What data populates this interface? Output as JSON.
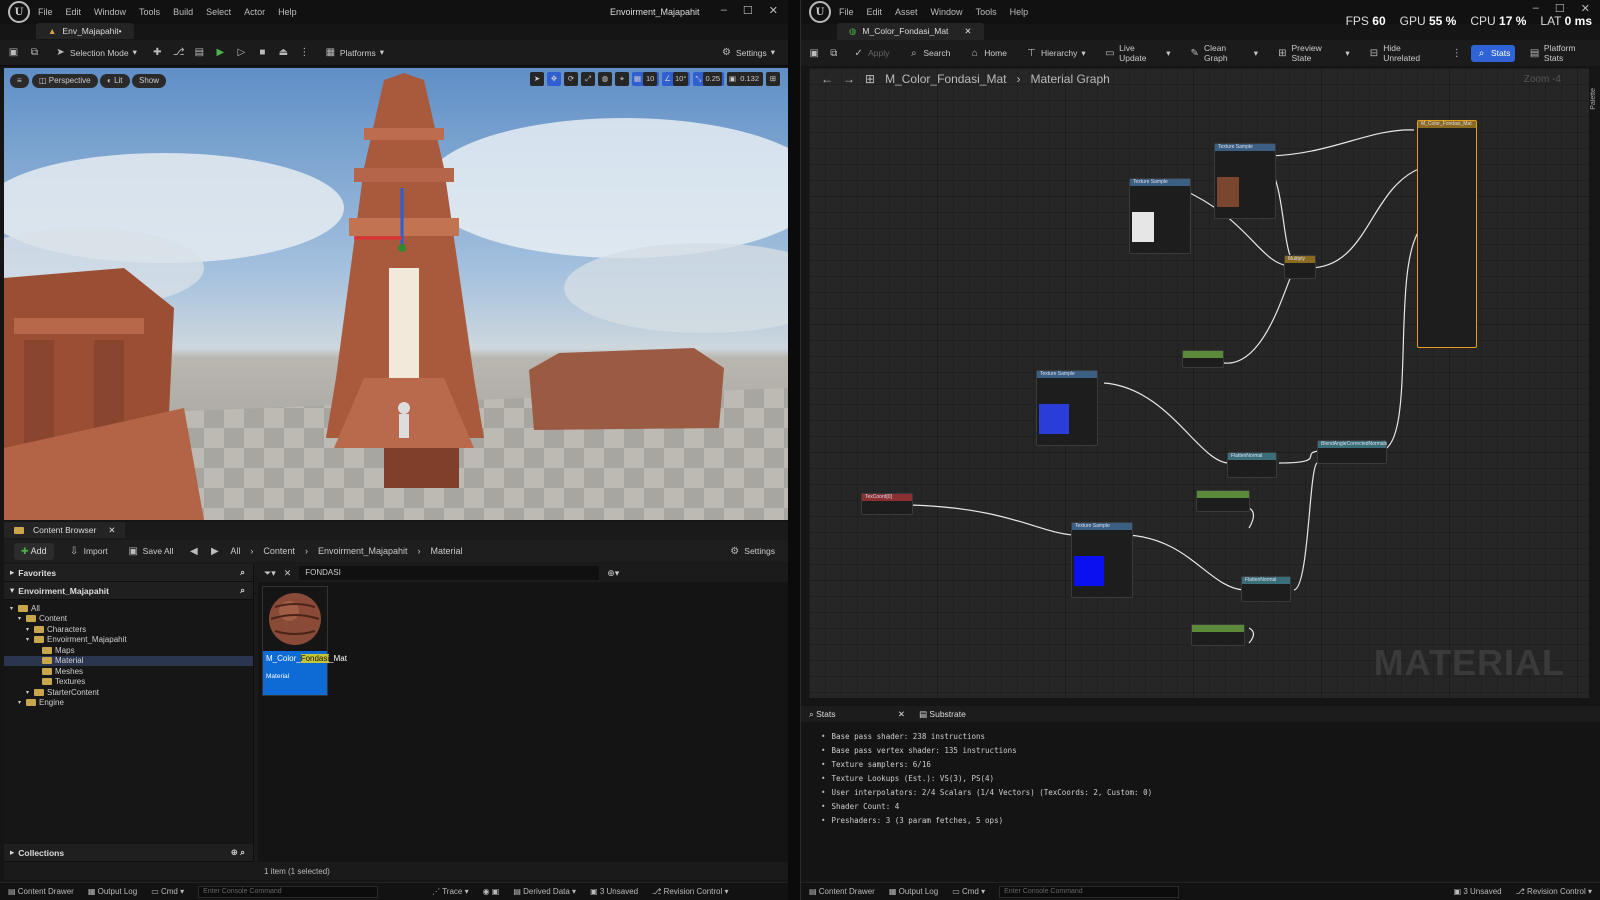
{
  "left": {
    "menu": [
      "File",
      "Edit",
      "Window",
      "Tools",
      "Build",
      "Select",
      "Actor",
      "Help"
    ],
    "title": "Envoirment_Majapahit",
    "tab": "Env_Majapahit•",
    "toolbar": {
      "mode": "Selection Mode",
      "platforms": "Platforms",
      "settings": "Settings"
    },
    "viewport": {
      "perspective": "Perspective",
      "lit": "Lit",
      "show": "Show",
      "grid": "10",
      "angle": "10°",
      "scale": "0.25",
      "camera": "0.132"
    },
    "cb": {
      "tab": "Content Browser",
      "add": "Add",
      "import": "Import",
      "save_all": "Save All",
      "crumbs": [
        "All",
        "Content",
        "Envoirment_Majapahit",
        "Material"
      ],
      "settings": "Settings",
      "favorites": "Favorites",
      "project": "Envoirment_Majapahit",
      "tree": [
        {
          "label": "All",
          "indent": 0
        },
        {
          "label": "Content",
          "indent": 1
        },
        {
          "label": "Characters",
          "indent": 2
        },
        {
          "label": "Envoirment_Majapahit",
          "indent": 2
        },
        {
          "label": "Maps",
          "indent": 3
        },
        {
          "label": "Material",
          "indent": 3,
          "selected": true
        },
        {
          "label": "Meshes",
          "indent": 3
        },
        {
          "label": "Textures",
          "indent": 3
        },
        {
          "label": "StarterContent",
          "indent": 2
        },
        {
          "label": "Engine",
          "indent": 1
        }
      ],
      "search": "FONDASI",
      "asset": {
        "pre": "M_Color_",
        "hl": "Fondasi",
        "post": "_Mat",
        "type": "Material"
      },
      "collections": "Collections",
      "count": "1 item (1 selected)"
    },
    "status": {
      "drawer": "Content Drawer",
      "output": "Output Log",
      "cmd": "Cmd",
      "console": "Enter Console Command",
      "trace": "Trace",
      "derived": "Derived Data",
      "unsaved": "3 Unsaved",
      "revision": "Revision Control"
    }
  },
  "right": {
    "menu": [
      "File",
      "Edit",
      "Asset",
      "Window",
      "Tools",
      "Help"
    ],
    "tab": "M_Color_Fondasi_Mat",
    "perf": {
      "fps_l": "FPS",
      "fps": "60",
      "gpu_l": "GPU",
      "gpu": "55 %",
      "cpu_l": "CPU",
      "cpu": "17 %",
      "lat_l": "LAT",
      "lat": "0 ms"
    },
    "toolbar": [
      "Apply",
      "Search",
      "Home",
      "Hierarchy",
      "Live Update",
      "Clean Graph",
      "Preview State",
      "Hide Unrelated"
    ],
    "stats_btn": "Stats",
    "platform_stats": "Platform Stats",
    "crumb": {
      "asset": "M_Color_Fondasi_Mat",
      "graph": "Material Graph"
    },
    "zoom": "Zoom -4",
    "watermark": "MATERIAL",
    "palette": "Palette",
    "stats_tab": "Stats",
    "substrate_tab": "Substrate",
    "stats": [
      "Base pass shader: 238 instructions",
      "Base pass vertex shader: 135 instructions",
      "Texture samplers: 6/16",
      "Texture Lookups (Est.): VS(3), PS(4)",
      "User interpolators: 2/4 Scalars (1/4 Vectors) (TexCoords: 2, Custom: 0)",
      "Shader Count: 4",
      "Preshaders: 3  (3 param fetches, 5 ops)"
    ],
    "status": {
      "drawer": "Content Drawer",
      "output": "Output Log",
      "cmd": "Cmd",
      "console": "Enter Console Command",
      "unsaved": "3 Unsaved",
      "revision": "Revision Control"
    }
  },
  "colors": {
    "accent": "#2f63d6",
    "selected": "#0e6bd6",
    "green": "#4db34d"
  }
}
